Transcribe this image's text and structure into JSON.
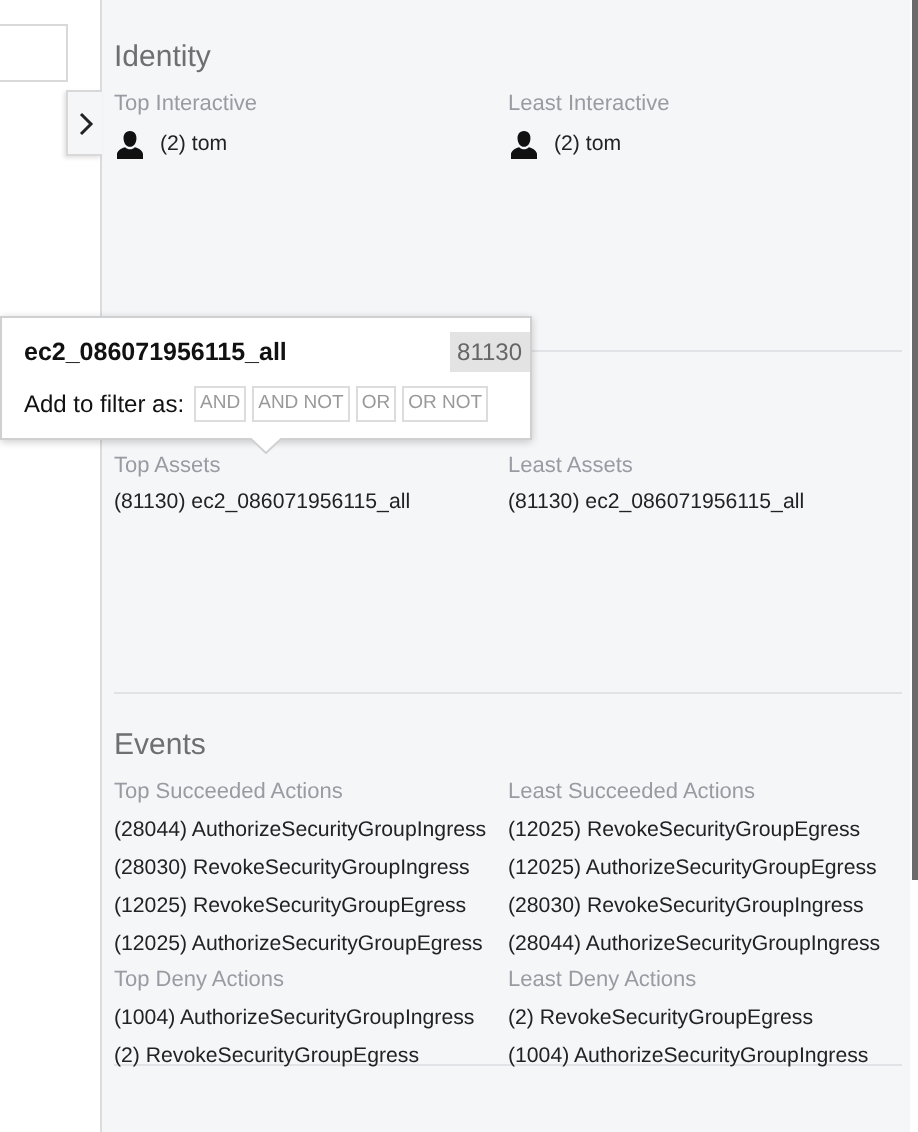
{
  "sections": [
    {
      "title": "Identity",
      "groups": [
        {
          "columns": [
            {
              "label": "Top Interactive",
              "items": [
                {
                  "kind": "user",
                  "text": "(2) tom"
                }
              ]
            },
            {
              "label": "Least Interactive",
              "items": [
                {
                  "kind": "user",
                  "text": "(2) tom"
                }
              ]
            }
          ]
        }
      ]
    },
    {
      "groups": [
        {
          "columns": [
            {
              "label": "Top Assets",
              "items": [
                {
                  "kind": "plain",
                  "text": "(81130) ec2_086071956115_all"
                }
              ]
            },
            {
              "label": "Least Assets",
              "items": [
                {
                  "kind": "plain",
                  "text": "(81130) ec2_086071956115_all"
                }
              ]
            }
          ]
        }
      ]
    },
    {
      "title": "Events",
      "groups": [
        {
          "columns": [
            {
              "label": "Top Succeeded Actions",
              "items": [
                {
                  "kind": "plain",
                  "text": "(28044) AuthorizeSecurityGroupIngress"
                },
                {
                  "kind": "plain",
                  "text": "(28030) RevokeSecurityGroupIngress"
                },
                {
                  "kind": "plain",
                  "text": "(12025) RevokeSecurityGroupEgress"
                },
                {
                  "kind": "plain",
                  "text": "(12025) AuthorizeSecurityGroupEgress"
                }
              ]
            },
            {
              "label": "Least Succeeded Actions",
              "items": [
                {
                  "kind": "plain",
                  "text": "(12025) RevokeSecurityGroupEgress"
                },
                {
                  "kind": "plain",
                  "text": "(12025) AuthorizeSecurityGroupEgress"
                },
                {
                  "kind": "plain",
                  "text": "(28030) RevokeSecurityGroupIngress"
                },
                {
                  "kind": "plain",
                  "text": "(28044) AuthorizeSecurityGroupIngress"
                }
              ]
            }
          ]
        },
        {
          "columns": [
            {
              "label": "Top Deny Actions",
              "items": [
                {
                  "kind": "plain",
                  "text": "(1004) AuthorizeSecurityGroupIngress"
                },
                {
                  "kind": "plain",
                  "text": "(2) RevokeSecurityGroupEgress"
                }
              ]
            },
            {
              "label": "Least Deny Actions",
              "items": [
                {
                  "kind": "plain",
                  "text": "(2) RevokeSecurityGroupEgress"
                },
                {
                  "kind": "plain",
                  "text": "(1004) AuthorizeSecurityGroupIngress"
                }
              ]
            }
          ]
        }
      ]
    }
  ],
  "popup": {
    "title": "ec2_086071956115_all",
    "count": "81130",
    "filter_label": "Add to filter as:",
    "buttons": [
      "AND",
      "AND NOT",
      "OR",
      "OR NOT"
    ]
  }
}
